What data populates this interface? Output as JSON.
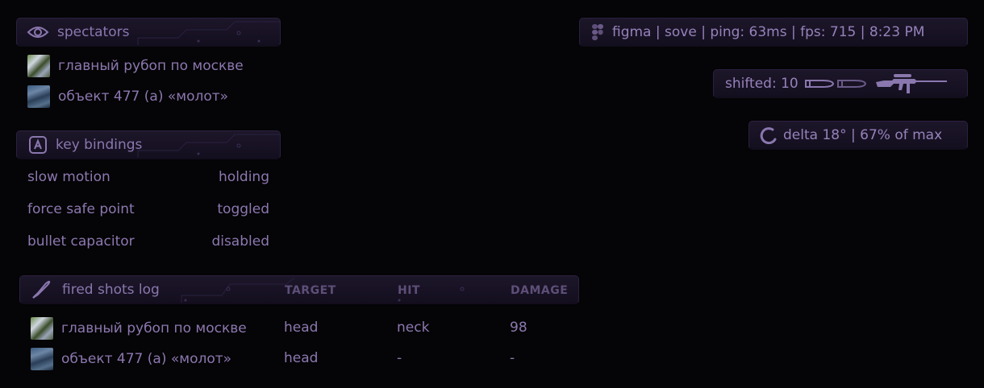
{
  "spectators": {
    "title": "spectators",
    "items": [
      {
        "name": "главный рубоп по москве"
      },
      {
        "name": "объект 477 (а) «молот»"
      }
    ]
  },
  "keybinds": {
    "title": "key bindings",
    "items": [
      {
        "name": "slow motion",
        "state": "holding"
      },
      {
        "name": "force safe point",
        "state": "toggled"
      },
      {
        "name": "bullet capacitor",
        "state": "disabled"
      }
    ]
  },
  "shots": {
    "title": "fired shots log",
    "columns": {
      "target": "TARGET",
      "hit": "HIT",
      "damage": "DAMAGE"
    },
    "rows": [
      {
        "name": "главный рубоп по москве",
        "target": "head",
        "hit": "neck",
        "damage": "98"
      },
      {
        "name": "объект 477 (а) «молот»",
        "target": "head",
        "hit": "-",
        "damage": "-"
      }
    ]
  },
  "watermark": {
    "text": "figma | sove | ping: 63ms | fps: 715 | 8:23 PM"
  },
  "shifted": {
    "text": "shifted: 10"
  },
  "delta": {
    "text": "delta 18° | 67% of max"
  },
  "colors": {
    "accent": "#8f7bb4",
    "panel": "#1c1629",
    "background": "#050406"
  }
}
